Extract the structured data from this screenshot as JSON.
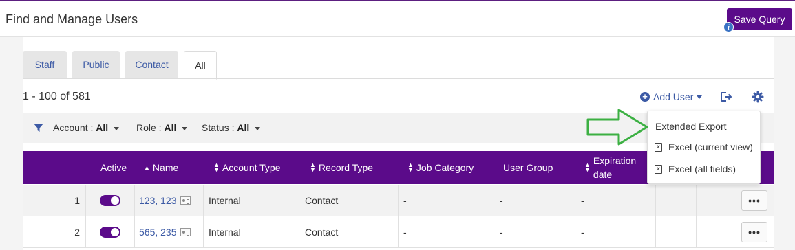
{
  "header": {
    "title": "Find and Manage Users",
    "save_query": "Save Query",
    "info_icon": "i"
  },
  "tabs": [
    {
      "label": "Staff",
      "active": false
    },
    {
      "label": "Public",
      "active": false
    },
    {
      "label": "Contact",
      "active": false
    },
    {
      "label": "All",
      "active": true
    }
  ],
  "toolbar": {
    "count": "1 - 100 of 581",
    "add_user": "Add User"
  },
  "filters": [
    {
      "label": "Account : ",
      "value": "All"
    },
    {
      "label": "Role : ",
      "value": "All"
    },
    {
      "label": "Status : ",
      "value": "All"
    }
  ],
  "columns": {
    "active": "Active",
    "name": "Name",
    "account_type": "Account Type",
    "record_type": "Record Type",
    "job_category": "Job Category",
    "user_group": "User Group",
    "expiration_1": "Expiration",
    "expiration_2": "date"
  },
  "rows": [
    {
      "num": "1",
      "name": "123, 123",
      "account_type": "Internal",
      "record_type": "Contact",
      "job_category": "-",
      "user_group": "-",
      "expiration": "-",
      "more": "•••"
    },
    {
      "num": "2",
      "name": "565, 235",
      "account_type": "Internal",
      "record_type": "Contact",
      "job_category": "-",
      "user_group": "-",
      "expiration": "-",
      "more": "•••"
    }
  ],
  "export_menu": {
    "title": "Extended Export",
    "items": [
      {
        "label": "Excel (current view)"
      },
      {
        "label": "Excel (all fields)"
      }
    ]
  },
  "colors": {
    "brand": "#5b0b8a",
    "link": "#3c5aa5",
    "annotation_arrow": "#3cb043"
  }
}
